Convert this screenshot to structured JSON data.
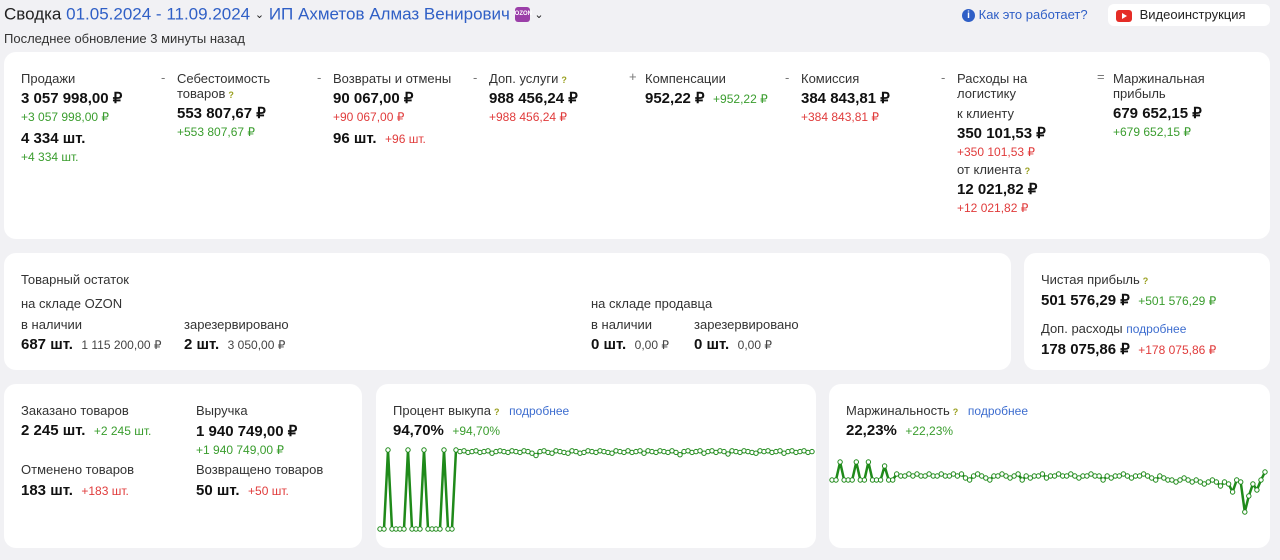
{
  "header": {
    "title": "Сводка",
    "date_range": "01.05.2024 - 11.09.2024",
    "seller": "ИП Ахметов Алмаз Венирович",
    "brand_badge": "OZON",
    "how_it_works": "Как это работает?",
    "video": "Видеоинструкция",
    "updated": "Последнее обновление 3 минуты назад"
  },
  "summary": {
    "sales": {
      "label": "Продажи",
      "value": "3 057 998,00 ₽",
      "delta": "+3 057 998,00 ₽",
      "qty": "4 334 шт.",
      "qty_delta": "+4 334 шт."
    },
    "cost": {
      "op": "-",
      "label": "Себестоимость товаров",
      "value": "553 807,67 ₽",
      "delta": "+553 807,67 ₽"
    },
    "returns": {
      "op": "-",
      "label": "Возвраты и отмены",
      "value": "90 067,00 ₽",
      "delta": "+90 067,00 ₽",
      "qty": "96 шт.",
      "qty_delta": "+96 шт."
    },
    "extra_services": {
      "op": "-",
      "label": "Доп. услуги",
      "value": "988 456,24 ₽",
      "delta": "+988 456,24 ₽"
    },
    "compensation": {
      "op": "+",
      "label": "Компенсации",
      "value": "952,22 ₽",
      "delta": "+952,22 ₽"
    },
    "commission": {
      "op": "-",
      "label": "Комиссия",
      "value": "384 843,81 ₽",
      "delta": "+384 843,81 ₽"
    },
    "logistics": {
      "op": "-",
      "label": "Расходы на логистику",
      "to_client_label": "к клиенту",
      "to_client": "350 101,53 ₽",
      "to_client_delta": "+350 101,53 ₽",
      "from_client_label": "от клиента",
      "from_client": "12 021,82 ₽",
      "from_client_delta": "+12 021,82 ₽"
    },
    "margin": {
      "op": "=",
      "label": "Маржинальная прибыль",
      "value": "679 652,15 ₽",
      "delta": "+679 652,15 ₽"
    }
  },
  "stock": {
    "title": "Товарный остаток",
    "ozon_label": "на складе OZON",
    "seller_label": "на складе продавца",
    "available_label": "в наличии",
    "reserved_label": "зарезервировано",
    "ozon_available": "687 шт.",
    "ozon_available_sum": "1 115 200,00 ₽",
    "ozon_reserved": "2 шт.",
    "ozon_reserved_sum": "3 050,00 ₽",
    "seller_available": "0 шт.",
    "seller_available_sum": "0,00 ₽",
    "seller_reserved": "0 шт.",
    "seller_reserved_sum": "0,00 ₽"
  },
  "profit": {
    "net_label": "Чистая прибыль",
    "net": "501 576,29 ₽",
    "net_delta": "+501 576,29 ₽",
    "extra_label": "Доп. расходы",
    "extra_link": "подробнее",
    "extra": "178 075,86 ₽",
    "extra_delta": "+178 075,86 ₽"
  },
  "orders": {
    "ordered_label": "Заказано товаров",
    "ordered": "2 245 шт.",
    "ordered_delta": "+2 245 шт.",
    "revenue_label": "Выручка",
    "revenue": "1 940 749,00 ₽",
    "revenue_delta": "+1 940 749,00 ₽",
    "cancelled_label": "Отменено товаров",
    "cancelled": "183 шт.",
    "cancelled_delta": "+183 шт.",
    "returned_label": "Возвращено товаров",
    "returned": "50 шт.",
    "returned_delta": "+50 шт."
  },
  "buyout": {
    "label": "Процент выкупа",
    "link": "подробнее",
    "value": "94,70%",
    "delta": "+94,70%"
  },
  "marginality": {
    "label": "Маржинальность",
    "link": "подробнее",
    "value": "22,23%",
    "delta": "+22,23%"
  },
  "chart_data": [
    {
      "type": "line",
      "name": "buyout-sparkline",
      "color": "#1f8a1a",
      "values": [
        0,
        0,
        100,
        0,
        0,
        0,
        0,
        100,
        0,
        0,
        0,
        100,
        0,
        0,
        0,
        0,
        100,
        0,
        0,
        100,
        98,
        99,
        97,
        98,
        99,
        97,
        98,
        99,
        96,
        98,
        99,
        98,
        97,
        99,
        98,
        97,
        99,
        98,
        96,
        93,
        98,
        99,
        97,
        96,
        99,
        98,
        97,
        96,
        99,
        98,
        96,
        97,
        99,
        98,
        97,
        99,
        98,
        97,
        96,
        99,
        98,
        97,
        99,
        97,
        98,
        99,
        96,
        99,
        98,
        97,
        99,
        98,
        97,
        99,
        97,
        94,
        98,
        99,
        97,
        98,
        99,
        96,
        98,
        99,
        97,
        99,
        98,
        95,
        99,
        98,
        97,
        99,
        98,
        97,
        96,
        99,
        98,
        99,
        97,
        98,
        99,
        96,
        98,
        99,
        97,
        98,
        99,
        97,
        98
      ]
    },
    {
      "type": "line",
      "name": "marginality-sparkline",
      "color": "#1f8a1a",
      "values": [
        22,
        22,
        31,
        22,
        22,
        22,
        31,
        22,
        22,
        31,
        22,
        22,
        22,
        29,
        22,
        22,
        25,
        24,
        24,
        25,
        24,
        25,
        24,
        24,
        25,
        24,
        24,
        25,
        24,
        24,
        25,
        24,
        25,
        23,
        22,
        24,
        25,
        24,
        23,
        22,
        24,
        24,
        25,
        24,
        23,
        24,
        25,
        22,
        24,
        23,
        24,
        24,
        25,
        23,
        24,
        24,
        25,
        24,
        24,
        25,
        24,
        23,
        24,
        24,
        25,
        24,
        24,
        22,
        24,
        23,
        24,
        24,
        25,
        24,
        23,
        24,
        24,
        25,
        24,
        23,
        22,
        24,
        23,
        22,
        22,
        21,
        22,
        23,
        22,
        21,
        22,
        21,
        20,
        21,
        22,
        21,
        19,
        21,
        20,
        16,
        22,
        21,
        6,
        14,
        20,
        17,
        22,
        26
      ]
    }
  ]
}
